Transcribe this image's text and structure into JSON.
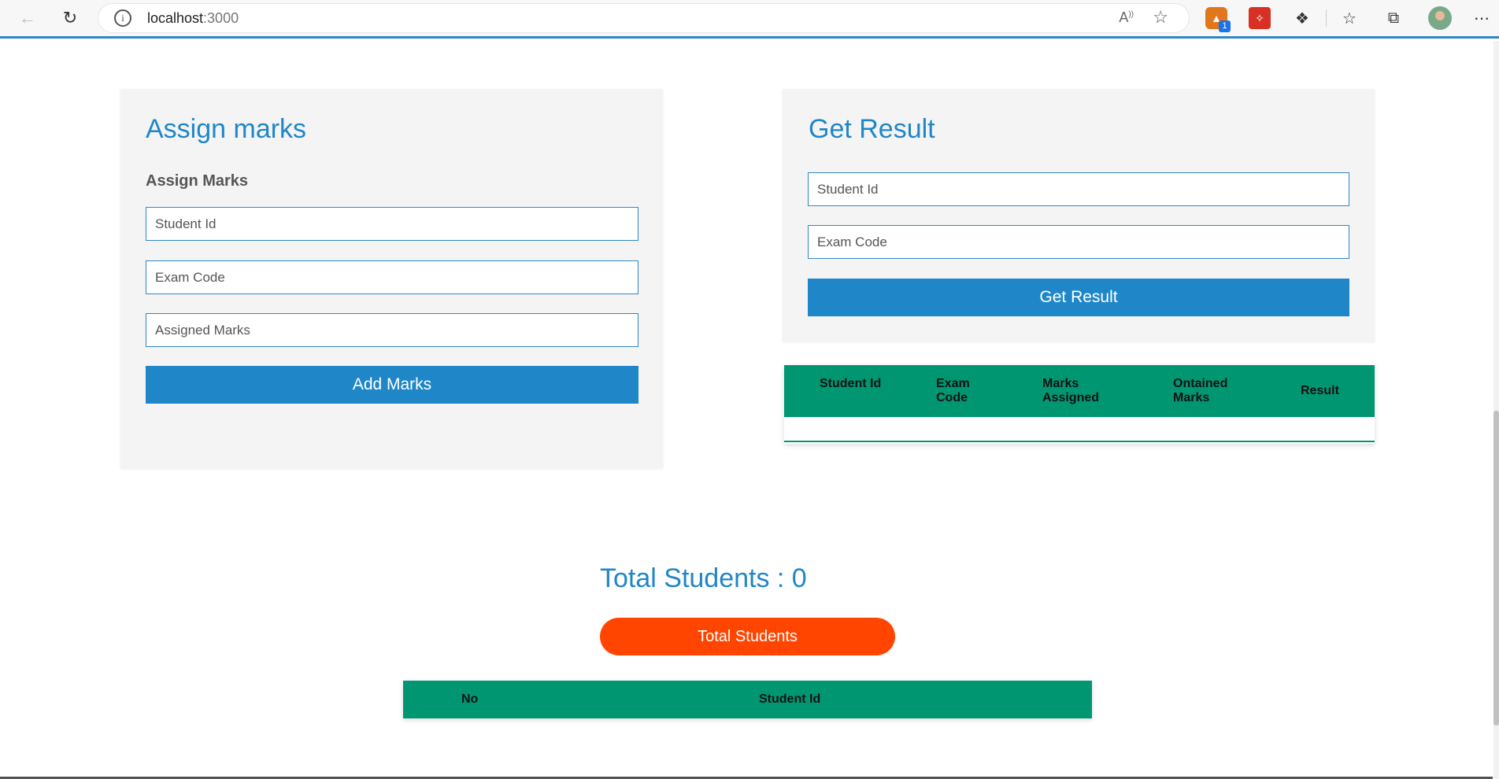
{
  "browser": {
    "url_host": "localhost",
    "url_port": ":3000",
    "back_icon": "arrow-left-icon",
    "reload_icon": "reload-icon",
    "info_icon": "info-icon",
    "read_aloud_icon": "read-aloud-icon",
    "add_favorite_icon": "star-plus-icon",
    "extension_badge": "1",
    "accent": "#2f86c6"
  },
  "assign_panel": {
    "title": "Assign marks",
    "subtitle": "Assign Marks",
    "student_id_placeholder": "Student Id",
    "exam_code_placeholder": "Exam Code",
    "assigned_marks_placeholder": "Assigned Marks",
    "add_button": "Add Marks"
  },
  "result_panel": {
    "title": "Get Result",
    "student_id_placeholder": "Student Id",
    "exam_code_placeholder": "Exam Code",
    "get_button": "Get Result"
  },
  "result_table": {
    "headers": [
      "Student Id",
      "Exam Code",
      "Marks Assigned",
      "Ontained Marks",
      "Result"
    ],
    "header_color": "#009672"
  },
  "totals": {
    "title": "Total Students : 0",
    "button": "Total Students",
    "button_color": "#ff4500"
  },
  "students_table": {
    "headers": [
      "No",
      "Student Id"
    ]
  }
}
